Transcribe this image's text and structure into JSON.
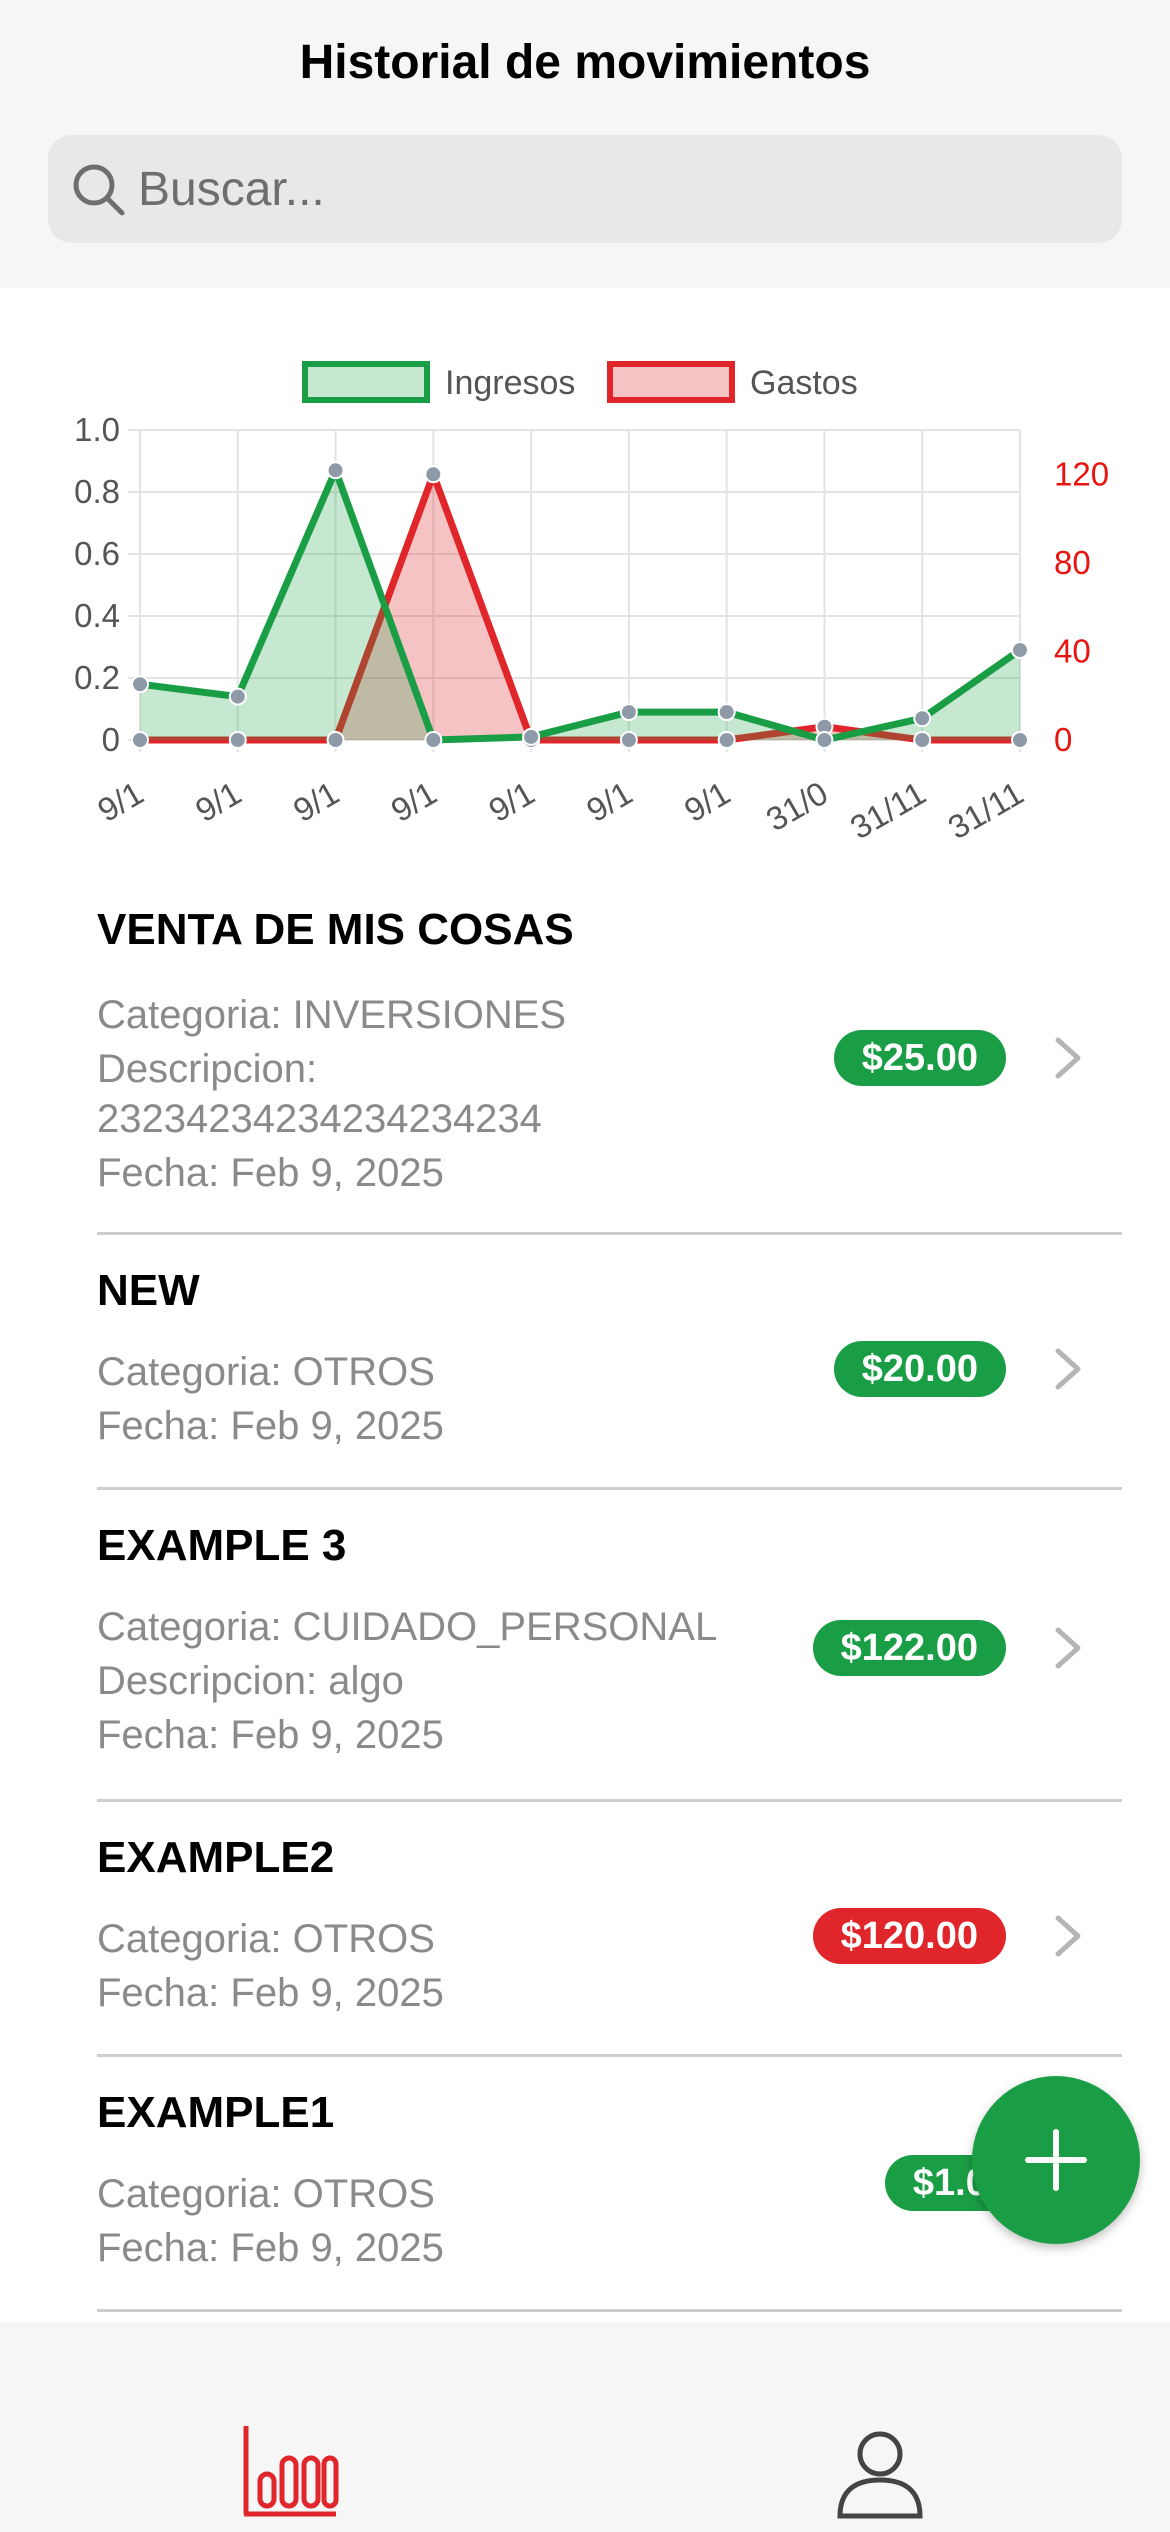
{
  "header": {
    "title": "Historial de movimientos",
    "search_placeholder": "Buscar..."
  },
  "colors": {
    "income": "#1a9e45",
    "expense": "#e0262a",
    "accent": "#e0262a"
  },
  "chart_data": {
    "type": "line",
    "categories": [
      "9/1",
      "9/1",
      "9/1",
      "9/1",
      "9/1",
      "9/1",
      "9/1",
      "31/0",
      "31/11",
      "31/11"
    ],
    "series": [
      {
        "name": "Ingresos",
        "axis": "left",
        "color": "#1a9e45",
        "values": [
          0.18,
          0.14,
          0.87,
          0.0,
          0.01,
          0.09,
          0.09,
          0.0,
          0.07,
          0.29
        ]
      },
      {
        "name": "Gastos",
        "axis": "right",
        "color": "#e0262a",
        "values": [
          0,
          0,
          0,
          120,
          0,
          0,
          0,
          6,
          0,
          0
        ]
      }
    ],
    "y_left": {
      "min": 0,
      "max": 1.0,
      "ticks": [
        "0",
        "0.2",
        "0.4",
        "0.6",
        "0.8",
        "1.0"
      ]
    },
    "y_right": {
      "min": 0,
      "max": 140,
      "ticks": [
        "0",
        "40",
        "80",
        "120"
      ]
    },
    "legend_position": "top",
    "grid": true
  },
  "transactions": [
    {
      "name": "VENTA DE MIS COSAS",
      "lines": [
        "Categoria: INVERSIONES",
        "Descripcion:",
        "23234234234234234234",
        "Fecha: Feb 9, 2025"
      ],
      "amount": "$25.00",
      "kind": "income"
    },
    {
      "name": "NEW",
      "lines": [
        "Categoria: OTROS",
        "Fecha: Feb 9, 2025"
      ],
      "amount": "$20.00",
      "kind": "income"
    },
    {
      "name": "EXAMPLE 3",
      "lines": [
        "Categoria: CUIDADO_PERSONAL",
        "Descripcion: algo",
        "Fecha: Feb 9, 2025"
      ],
      "amount": "$122.00",
      "kind": "income"
    },
    {
      "name": "EXAMPLE2",
      "lines": [
        "Categoria: OTROS",
        "Fecha: Feb 9, 2025"
      ],
      "amount": "$120.00",
      "kind": "expense"
    },
    {
      "name": "EXAMPLE1",
      "lines": [
        "Categoria: OTROS",
        "Fecha: Feb 9, 2025"
      ],
      "amount": "$1.00",
      "kind": "income"
    }
  ],
  "fab": {
    "icon": "plus-icon"
  },
  "tabbar": {
    "tabs": [
      {
        "icon": "stats-icon",
        "active": true
      },
      {
        "icon": "profile-icon",
        "active": false
      }
    ]
  }
}
